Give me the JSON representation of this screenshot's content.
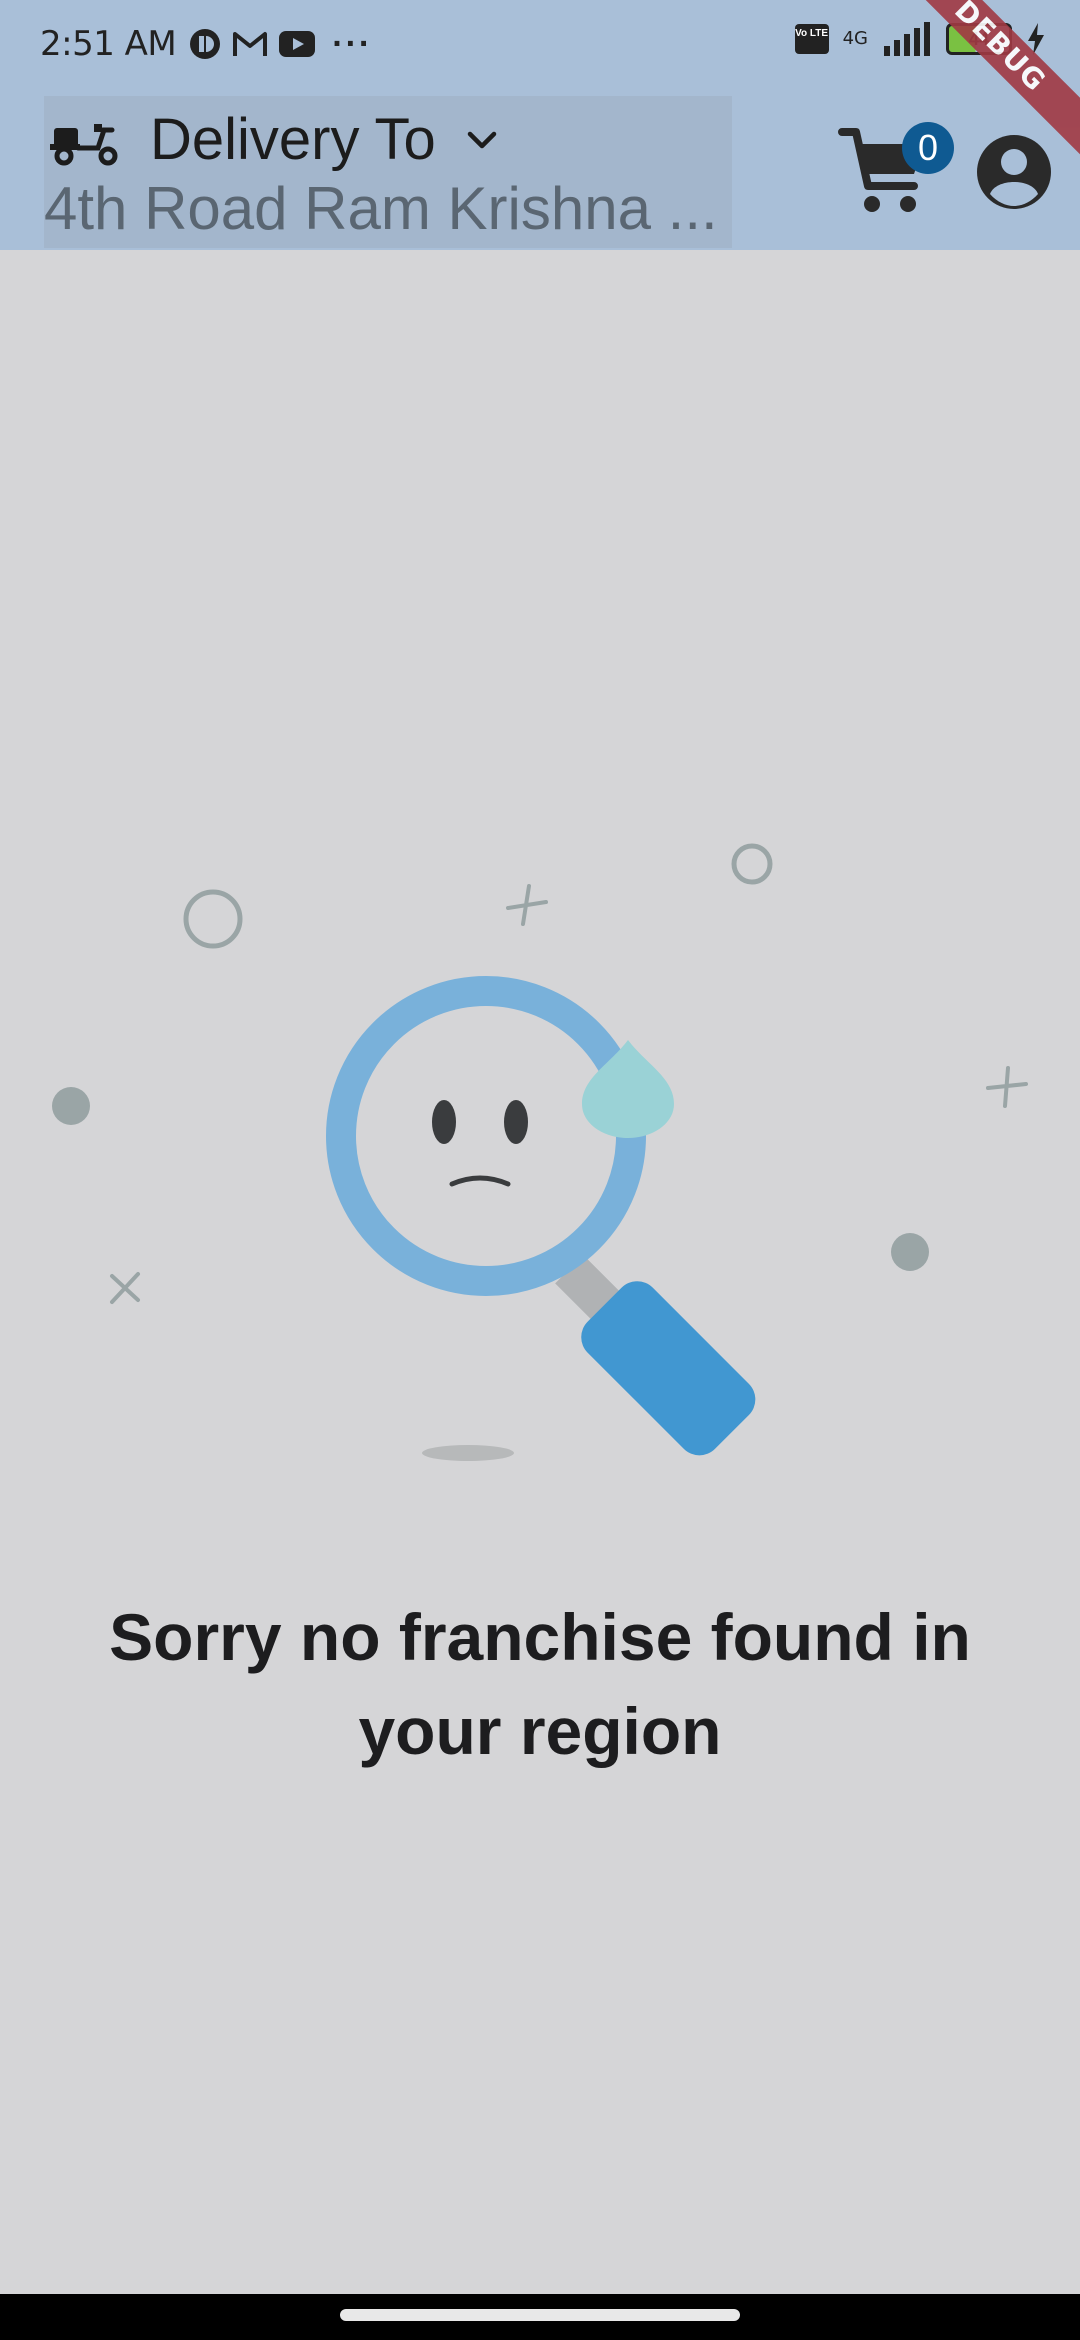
{
  "status_bar": {
    "time": "2:51 AM",
    "network": "4G",
    "battery": "44",
    "volte": "Vo LTE"
  },
  "debug_banner": "DEBUG",
  "header": {
    "delivery_label": "Delivery To",
    "address": "4th Road Ram Krishna ...",
    "cart_count": "0"
  },
  "empty_state": {
    "message": "Sorry no franchise found in your region"
  },
  "colors": {
    "app_bar": "#a9bfd8",
    "background": "#d5d5d7",
    "badge": "#0f5a92",
    "lens_ring": "#79b1da",
    "handle": "#4197d1"
  }
}
